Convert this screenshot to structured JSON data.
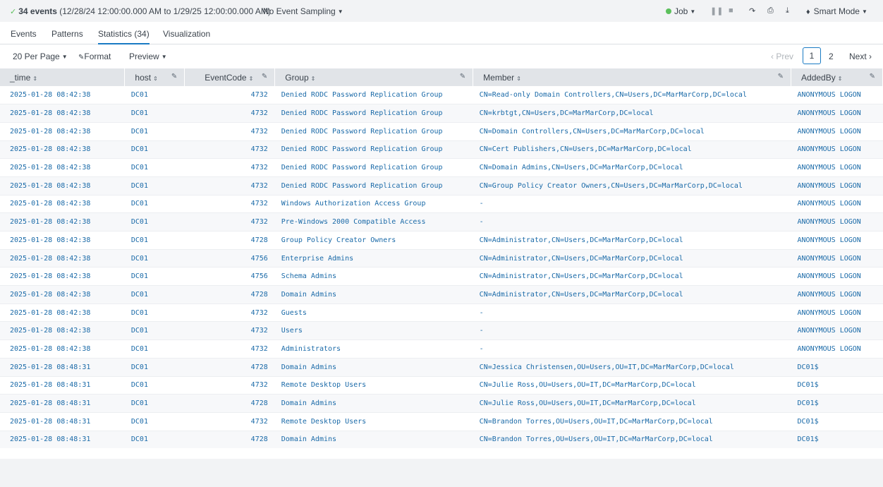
{
  "topbar": {
    "events_count": "34 events",
    "time_range": "(12/28/24 12:00:00.000 AM to 1/29/25 12:00:00.000 AM)",
    "sampling": "No Event Sampling",
    "job": "Job",
    "mode": "Smart Mode"
  },
  "tabs": [
    "Events",
    "Patterns",
    "Statistics (34)",
    "Visualization"
  ],
  "toolbar": {
    "per_page": "20 Per Page",
    "format": "Format",
    "preview": "Preview"
  },
  "pager": {
    "prev": "Prev",
    "current": "1",
    "second": "2",
    "next": "Next"
  },
  "columns": [
    "_time",
    "host",
    "EventCode",
    "Group",
    "Member",
    "AddedBy"
  ],
  "rows": [
    [
      "2025-01-28 08:42:38",
      "DC01",
      "4732",
      "Denied RODC Password Replication Group",
      "CN=Read-only Domain Controllers,CN=Users,DC=MarMarCorp,DC=local",
      "ANONYMOUS LOGON"
    ],
    [
      "2025-01-28 08:42:38",
      "DC01",
      "4732",
      "Denied RODC Password Replication Group",
      "CN=krbtgt,CN=Users,DC=MarMarCorp,DC=local",
      "ANONYMOUS LOGON"
    ],
    [
      "2025-01-28 08:42:38",
      "DC01",
      "4732",
      "Denied RODC Password Replication Group",
      "CN=Domain Controllers,CN=Users,DC=MarMarCorp,DC=local",
      "ANONYMOUS LOGON"
    ],
    [
      "2025-01-28 08:42:38",
      "DC01",
      "4732",
      "Denied RODC Password Replication Group",
      "CN=Cert Publishers,CN=Users,DC=MarMarCorp,DC=local",
      "ANONYMOUS LOGON"
    ],
    [
      "2025-01-28 08:42:38",
      "DC01",
      "4732",
      "Denied RODC Password Replication Group",
      "CN=Domain Admins,CN=Users,DC=MarMarCorp,DC=local",
      "ANONYMOUS LOGON"
    ],
    [
      "2025-01-28 08:42:38",
      "DC01",
      "4732",
      "Denied RODC Password Replication Group",
      "CN=Group Policy Creator Owners,CN=Users,DC=MarMarCorp,DC=local",
      "ANONYMOUS LOGON"
    ],
    [
      "2025-01-28 08:42:38",
      "DC01",
      "4732",
      "Windows Authorization Access Group",
      "-",
      "ANONYMOUS LOGON"
    ],
    [
      "2025-01-28 08:42:38",
      "DC01",
      "4732",
      "Pre-Windows 2000 Compatible Access",
      "-",
      "ANONYMOUS LOGON"
    ],
    [
      "2025-01-28 08:42:38",
      "DC01",
      "4728",
      "Group Policy Creator Owners",
      "CN=Administrator,CN=Users,DC=MarMarCorp,DC=local",
      "ANONYMOUS LOGON"
    ],
    [
      "2025-01-28 08:42:38",
      "DC01",
      "4756",
      "Enterprise Admins",
      "CN=Administrator,CN=Users,DC=MarMarCorp,DC=local",
      "ANONYMOUS LOGON"
    ],
    [
      "2025-01-28 08:42:38",
      "DC01",
      "4756",
      "Schema Admins",
      "CN=Administrator,CN=Users,DC=MarMarCorp,DC=local",
      "ANONYMOUS LOGON"
    ],
    [
      "2025-01-28 08:42:38",
      "DC01",
      "4728",
      "Domain Admins",
      "CN=Administrator,CN=Users,DC=MarMarCorp,DC=local",
      "ANONYMOUS LOGON"
    ],
    [
      "2025-01-28 08:42:38",
      "DC01",
      "4732",
      "Guests",
      "-",
      "ANONYMOUS LOGON"
    ],
    [
      "2025-01-28 08:42:38",
      "DC01",
      "4732",
      "Users",
      "-",
      "ANONYMOUS LOGON"
    ],
    [
      "2025-01-28 08:42:38",
      "DC01",
      "4732",
      "Administrators",
      "-",
      "ANONYMOUS LOGON"
    ],
    [
      "2025-01-28 08:48:31",
      "DC01",
      "4728",
      "Domain Admins",
      "CN=Jessica Christensen,OU=Users,OU=IT,DC=MarMarCorp,DC=local",
      "DC01$"
    ],
    [
      "2025-01-28 08:48:31",
      "DC01",
      "4732",
      "Remote Desktop Users",
      "CN=Julie Ross,OU=Users,OU=IT,DC=MarMarCorp,DC=local",
      "DC01$"
    ],
    [
      "2025-01-28 08:48:31",
      "DC01",
      "4728",
      "Domain Admins",
      "CN=Julie Ross,OU=Users,OU=IT,DC=MarMarCorp,DC=local",
      "DC01$"
    ],
    [
      "2025-01-28 08:48:31",
      "DC01",
      "4732",
      "Remote Desktop Users",
      "CN=Brandon Torres,OU=Users,OU=IT,DC=MarMarCorp,DC=local",
      "DC01$"
    ],
    [
      "2025-01-28 08:48:31",
      "DC01",
      "4728",
      "Domain Admins",
      "CN=Brandon Torres,OU=Users,OU=IT,DC=MarMarCorp,DC=local",
      "DC01$"
    ]
  ]
}
